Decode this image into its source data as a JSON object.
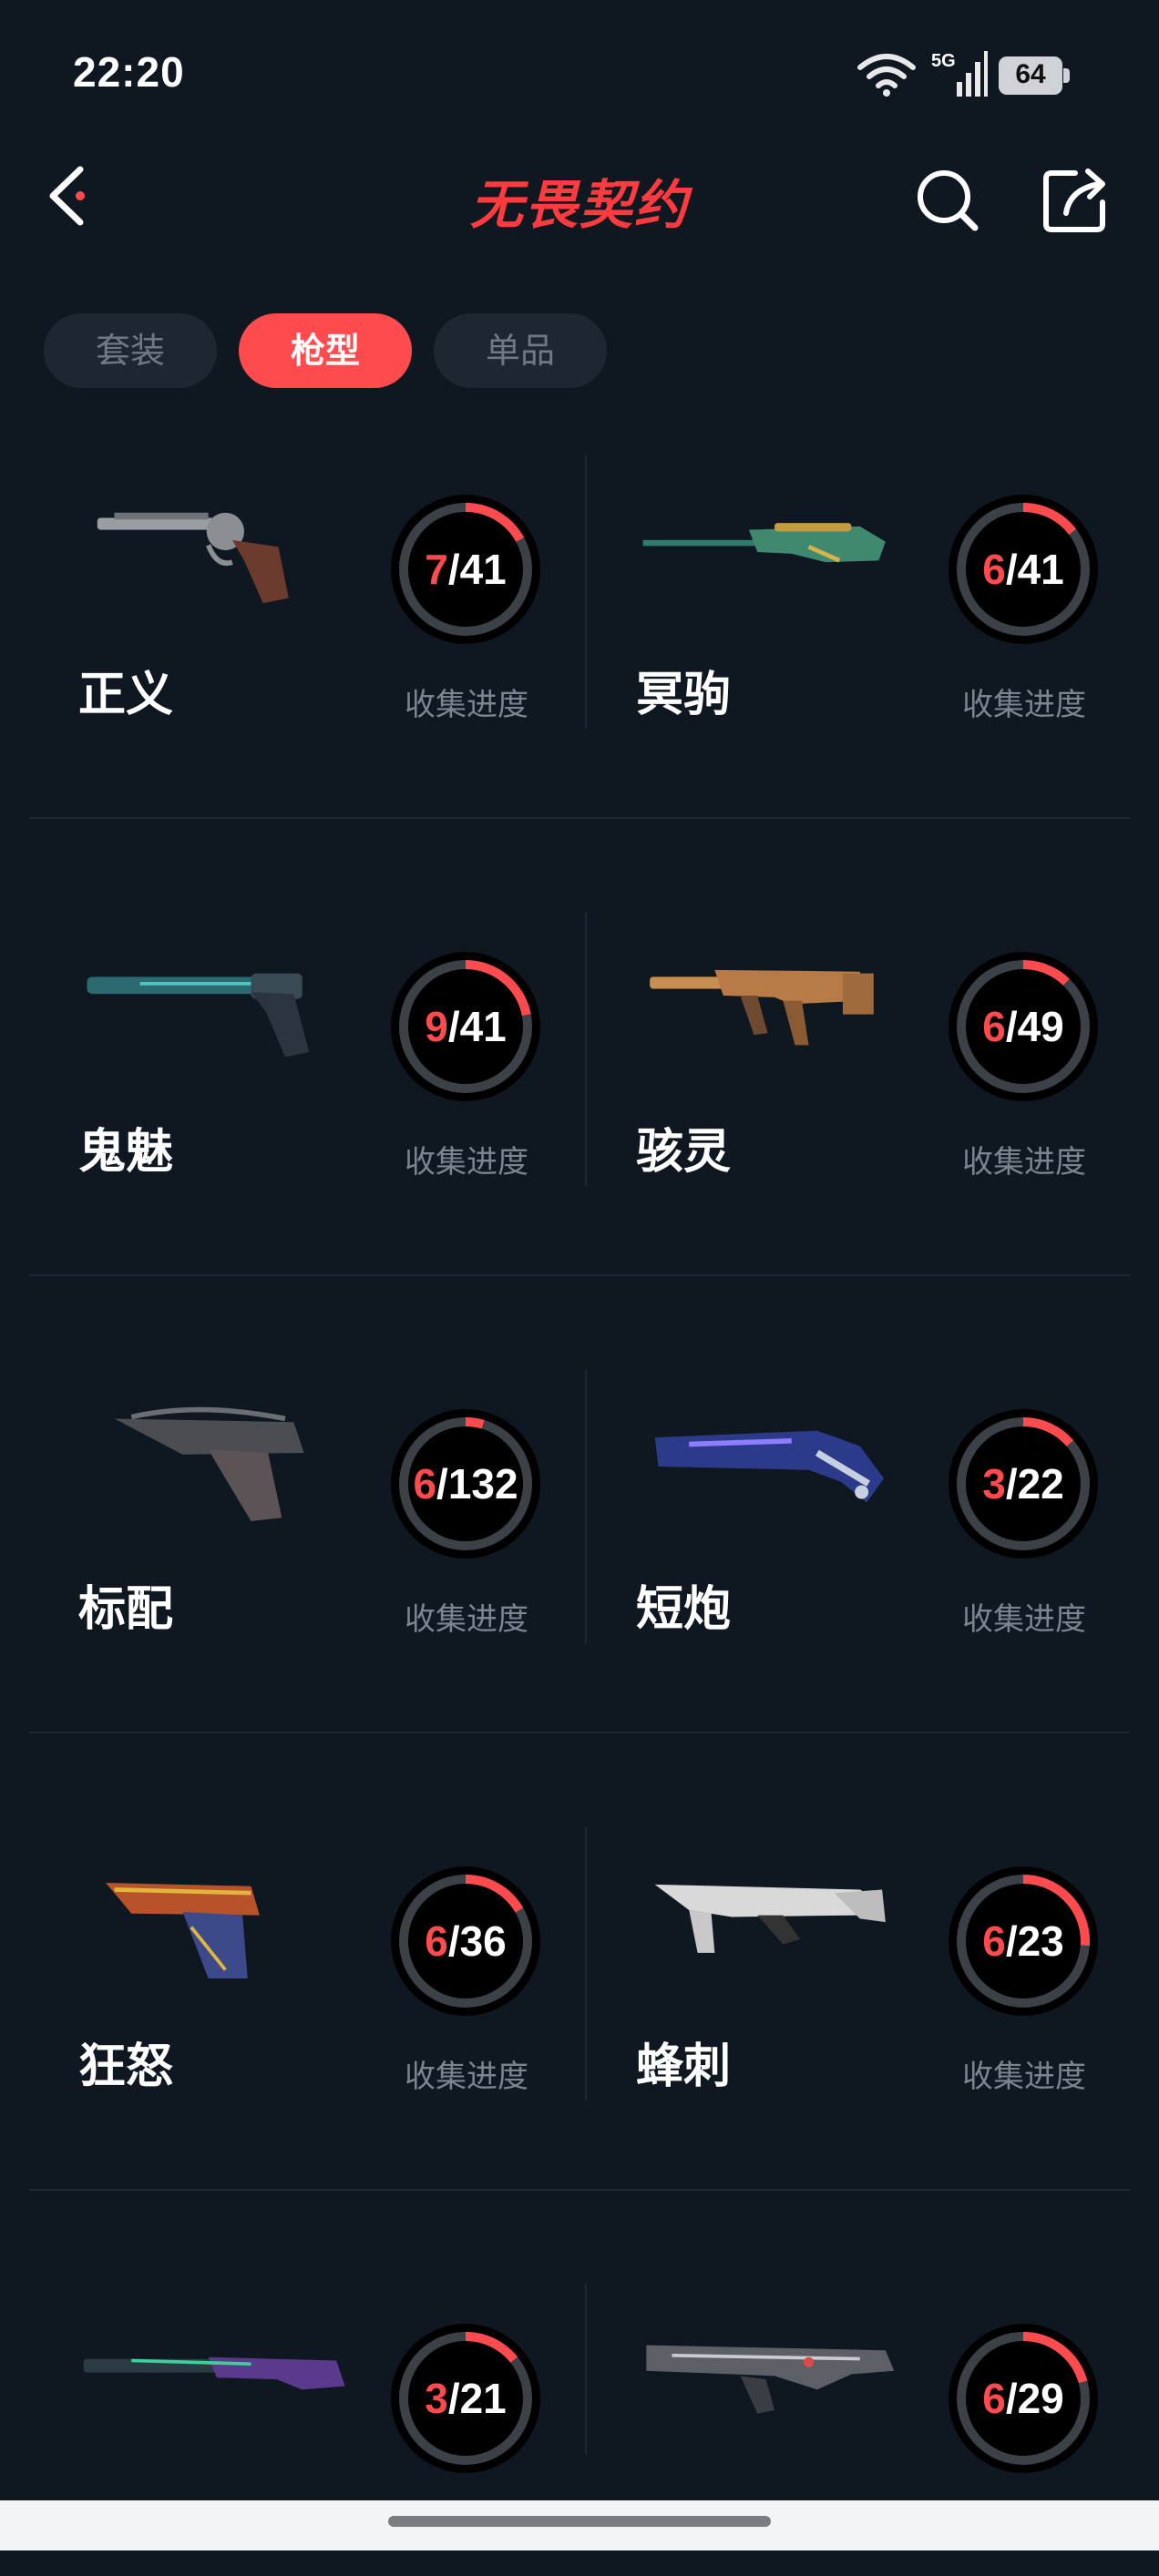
{
  "status_bar": {
    "time": "22:20",
    "network": "5G",
    "battery": "64"
  },
  "header": {
    "title": "无畏契约"
  },
  "tabs": [
    {
      "label": "套装",
      "active": false
    },
    {
      "label": "枪型",
      "active": true
    },
    {
      "label": "单品",
      "active": false
    }
  ],
  "colors": {
    "accent": "#ff4b4e",
    "background": "#0f1721",
    "ring_track": "#3b4147",
    "ring_fill": "#ff4b4e"
  },
  "progress_label": "收集进度",
  "weapons": [
    {
      "name": "正义",
      "collected": 7,
      "total": 41
    },
    {
      "name": "冥驹",
      "collected": 6,
      "total": 41
    },
    {
      "name": "鬼魅",
      "collected": 9,
      "total": 41
    },
    {
      "name": "骇灵",
      "collected": 6,
      "total": 49
    },
    {
      "name": "标配",
      "collected": 6,
      "total": 132
    },
    {
      "name": "短炮",
      "collected": 3,
      "total": 22
    },
    {
      "name": "狂怒",
      "collected": 6,
      "total": 36
    },
    {
      "name": "蜂刺",
      "collected": 6,
      "total": 23
    },
    {
      "name": "",
      "collected": 3,
      "total": 21
    },
    {
      "name": "",
      "collected": 6,
      "total": 29
    }
  ]
}
